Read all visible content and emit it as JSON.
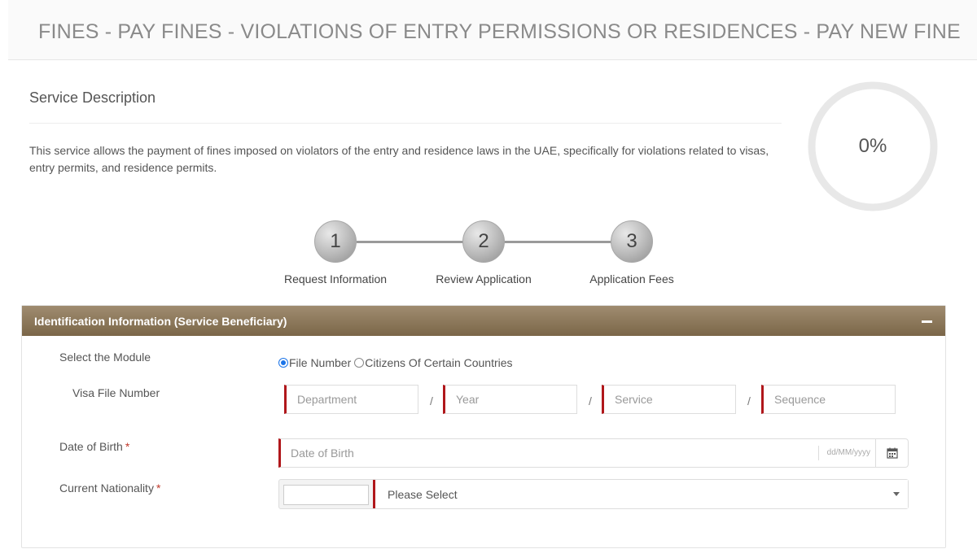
{
  "page": {
    "title": "FINES - PAY FINES - VIOLATIONS OF ENTRY PERMISSIONS OR RESIDENCES - PAY NEW FINE"
  },
  "description": {
    "heading": "Service Description",
    "text": "This service allows the payment of fines imposed on violators of the entry and residence laws in the UAE, specifically for violations related to visas, entry permits, and residence permits."
  },
  "progress": {
    "label": "0%",
    "value": 0
  },
  "steps": [
    {
      "number": "1",
      "label": "Request Information"
    },
    {
      "number": "2",
      "label": "Review Application"
    },
    {
      "number": "3",
      "label": "Application Fees"
    }
  ],
  "panel": {
    "title": "Identification Information (Service Beneficiary)",
    "module": {
      "label": "Select the Module",
      "options": [
        {
          "label": "File Number",
          "selected": true
        },
        {
          "label": "Citizens Of Certain Countries",
          "selected": false
        }
      ]
    },
    "visa_file": {
      "label": "Visa File Number",
      "placeholders": [
        "Department",
        "Year",
        "Service",
        "Sequence"
      ],
      "separator": "/"
    },
    "dob": {
      "label": "Date of Birth",
      "required_mark": "*",
      "placeholder": "Date of Birth",
      "format_hint": "dd/MM/yyyy"
    },
    "nationality": {
      "label": "Current Nationality",
      "required_mark": "*",
      "code_value": "",
      "selected": "Please Select"
    }
  },
  "colors": {
    "panel_header_top": "#a08c70",
    "panel_header_bottom": "#7b6648",
    "required_accent": "#b0171b",
    "radio_checked": "#1a73e8"
  }
}
